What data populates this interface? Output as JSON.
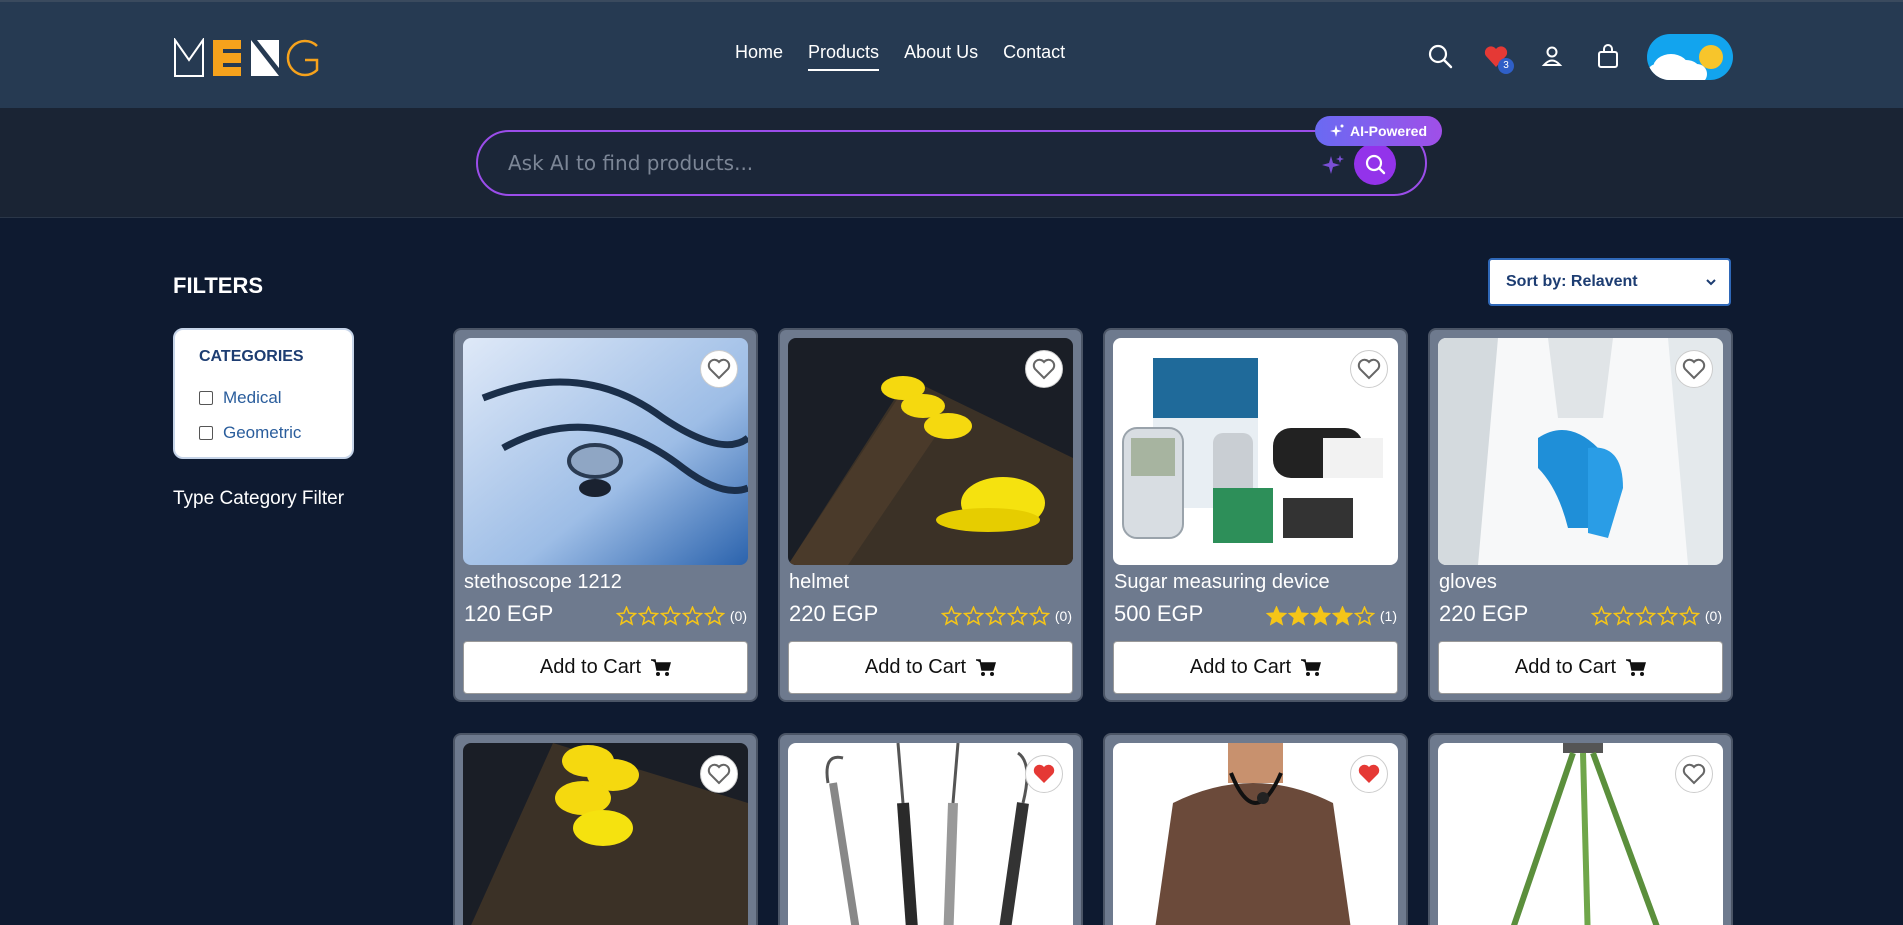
{
  "brand": {
    "logo_text": "MENG"
  },
  "nav": [
    {
      "label": "Home",
      "active": false
    },
    {
      "label": "Products",
      "active": true
    },
    {
      "label": "About Us",
      "active": false
    },
    {
      "label": "Contact",
      "active": false
    }
  ],
  "header_icons": {
    "wishlist_count": "3"
  },
  "ai_search": {
    "placeholder": "Ask AI to find products...",
    "badge": "AI-Powered"
  },
  "filters": {
    "title": "FILTERS",
    "categories_title": "CATEGORIES",
    "categories": [
      "Medical",
      "Geometric"
    ],
    "type_filter_label": "Type Category Filter"
  },
  "sort": {
    "label": "Sort by: Relavent"
  },
  "products": [
    {
      "name": "stethoscope 1212",
      "price": "120 EGP",
      "rating": 0,
      "reviews": "(0)",
      "favorited": false
    },
    {
      "name": "helmet",
      "price": "220 EGP",
      "rating": 0,
      "reviews": "(0)",
      "favorited": false
    },
    {
      "name": "Sugar measuring device",
      "price": "500 EGP",
      "rating": 4,
      "reviews": "(1)",
      "favorited": false
    },
    {
      "name": "gloves",
      "price": "220 EGP",
      "rating": 0,
      "reviews": "(0)",
      "favorited": false
    },
    {
      "name": "",
      "price": "",
      "rating": 0,
      "reviews": "",
      "favorited": false
    },
    {
      "name": "",
      "price": "",
      "rating": 0,
      "reviews": "",
      "favorited": true
    },
    {
      "name": "",
      "price": "",
      "rating": 0,
      "reviews": "",
      "favorited": true
    },
    {
      "name": "",
      "price": "",
      "rating": 0,
      "reviews": "",
      "favorited": false
    }
  ],
  "add_to_cart_label": "Add to Cart",
  "colors": {
    "header_bg": "#263a52",
    "page_bg": "#0e1a30",
    "card_bg": "#6e7a8e",
    "accent_purple": "#9333ea",
    "star_gold": "#f5c518",
    "heart_red": "#e53935"
  }
}
